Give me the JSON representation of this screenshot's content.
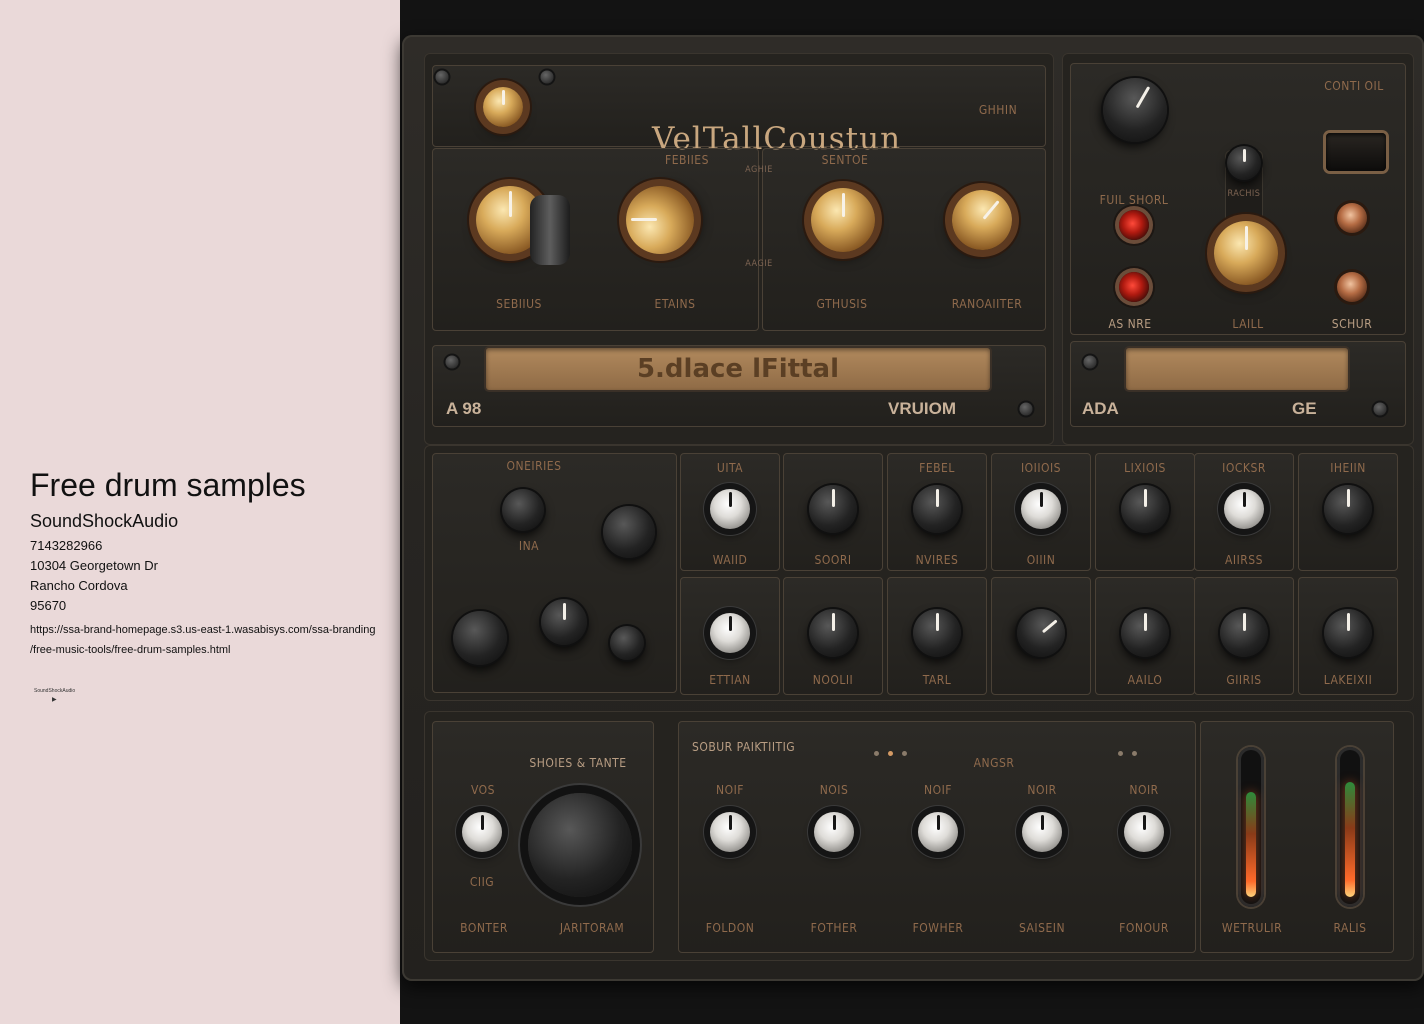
{
  "listing": {
    "title": "Free drum samples",
    "company": "SoundShockAudio",
    "phone": "7143282966",
    "street": "10304 Georgetown Dr",
    "city": "Rancho Cordova",
    "zip": "95670",
    "url_line1": "https://ssa-brand-homepage.s3.us-east-1.wasabisys.com/ssa-branding",
    "url_line2": "/free-music-tools/free-drum-samples.html",
    "mini_logo_text": "SoundShockAudio",
    "mini_logo_glyph": "▶"
  },
  "rack": {
    "brand_title": "VelTallCoustun",
    "gain_label": "GHHIN",
    "display_text": "5.dlace lFittal",
    "plate_left": "A 98",
    "plate_version": "VRUIOM",
    "right_plate_left": "ADA",
    "right_plate_right": "GE",
    "control_label": "CONTI OIL",
    "knob_labels": {
      "k1": "SEBIIUS",
      "k2": "ETAINS",
      "k3": "GTHUSIS",
      "k4": "RANOAIITER",
      "agie1": "AGHIE",
      "agie2": "AAGIE",
      "ferries": "FEBIIES",
      "sentoe": "SENTOE",
      "fulshorl": "FUIL SHORL",
      "rachis": "RACHIS",
      "asine": "AS NRE",
      "level": "LAILL",
      "schur": "SCHUR"
    },
    "row2": {
      "group1": [
        "ONEIRIES",
        "INA"
      ],
      "top": [
        [
          "UITA",
          "WAIID"
        ],
        [
          "",
          "SOORI"
        ],
        [
          "FEBEL",
          "NVIRES"
        ],
        [
          "IOIIOIS",
          "OIIIN"
        ],
        [
          "LIXIOIS",
          ""
        ],
        [
          "IOCKSR",
          "AIIRSS"
        ],
        [
          "IHEIIN",
          ""
        ]
      ],
      "bottom": [
        "ETTIAN",
        "NOOLII",
        "TARL",
        "",
        "AAILO",
        "GIIRIS",
        "LAKEIXII"
      ]
    },
    "row3": {
      "stack_label": "SHOIES & TANTE",
      "vos": "VOS",
      "cig": "CIIG",
      "bonter": "BONTER",
      "jarnoram": "JARITORAM",
      "sober": "SOBUR PAIKTIITIG",
      "anger": "ANGSR",
      "knobs": [
        "NOIF",
        "NOIS",
        "NOIF",
        "NOIR",
        "NOIR"
      ],
      "bottoms": [
        "FOLDON",
        "FOTHER",
        "FOWHER",
        "SAISEIN",
        "FONOUR"
      ],
      "meters": [
        "WETRULIR",
        "RALIS"
      ],
      "meter_levels": [
        0.75,
        0.82
      ]
    }
  }
}
